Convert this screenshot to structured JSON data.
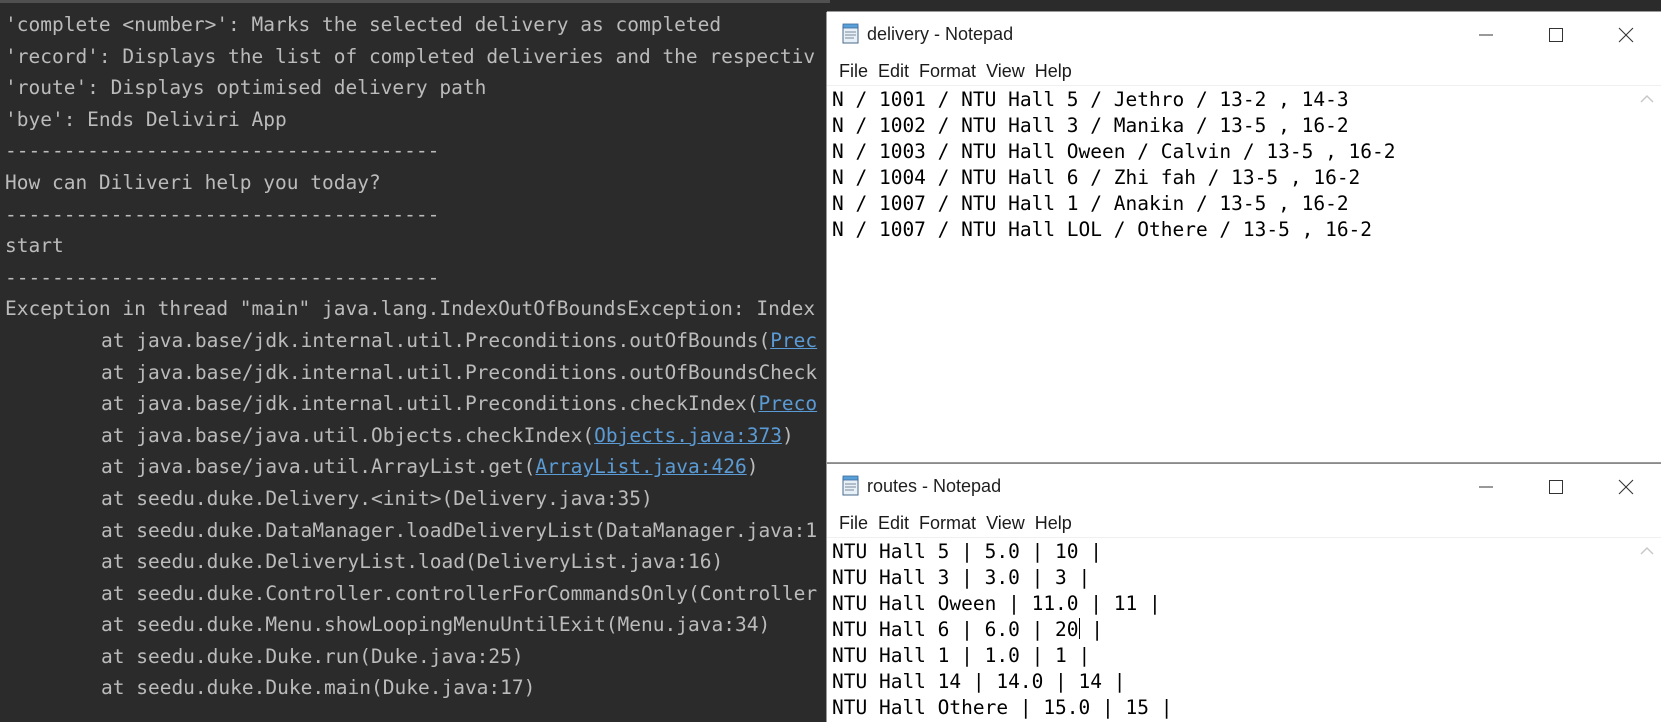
{
  "terminal": {
    "lines": [
      {
        "type": "plain",
        "text": "'complete <number>': Marks the selected delivery as completed"
      },
      {
        "type": "plain",
        "text": "'record': Displays the list of completed deliveries and the respectiv"
      },
      {
        "type": "plain",
        "text": "'route': Displays optimised delivery path"
      },
      {
        "type": "plain",
        "text": "'bye': Ends Deliviri App"
      },
      {
        "type": "plain",
        "text": "-------------------------------------"
      },
      {
        "type": "plain",
        "text": "How can Diliveri help you today?"
      },
      {
        "type": "plain",
        "text": "-------------------------------------"
      },
      {
        "type": "plain",
        "text": "start"
      },
      {
        "type": "plain",
        "text": "-------------------------------------"
      },
      {
        "type": "plain",
        "text": "Exception in thread \"main\" java.lang.IndexOutOfBoundsException: Index"
      },
      {
        "type": "stack",
        "pre": "at java.base/jdk.internal.util.Preconditions.outOfBounds(",
        "link": "Prec",
        "post": ""
      },
      {
        "type": "stack",
        "pre": "at java.base/jdk.internal.util.Preconditions.outOfBoundsCheck",
        "link": "",
        "post": ""
      },
      {
        "type": "stack",
        "pre": "at java.base/jdk.internal.util.Preconditions.checkIndex(",
        "link": "Preco",
        "post": ""
      },
      {
        "type": "stack",
        "pre": "at java.base/java.util.Objects.checkIndex(",
        "link": "Objects.java:373",
        "post": ")"
      },
      {
        "type": "stack",
        "pre": "at java.base/java.util.ArrayList.get(",
        "link": "ArrayList.java:426",
        "post": ")"
      },
      {
        "type": "stack",
        "pre": "at seedu.duke.Delivery.<init>(Delivery.java:35)",
        "link": "",
        "post": ""
      },
      {
        "type": "stack",
        "pre": "at seedu.duke.DataManager.loadDeliveryList(DataManager.java:1",
        "link": "",
        "post": ""
      },
      {
        "type": "stack",
        "pre": "at seedu.duke.DeliveryList.load(DeliveryList.java:16)",
        "link": "",
        "post": ""
      },
      {
        "type": "stack",
        "pre": "at seedu.duke.Controller.controllerForCommandsOnly(Controller",
        "link": "",
        "post": ""
      },
      {
        "type": "stack",
        "pre": "at seedu.duke.Menu.showLoopingMenuUntilExit(Menu.java:34)",
        "link": "",
        "post": ""
      },
      {
        "type": "stack",
        "pre": "at seedu.duke.Duke.run(Duke.java:25)",
        "link": "",
        "post": ""
      },
      {
        "type": "stack",
        "pre": "at seedu.duke.Duke.main(Duke.java:17)",
        "link": "",
        "post": ""
      }
    ]
  },
  "delivery_window": {
    "title": "delivery - Notepad",
    "menu": [
      "File",
      "Edit",
      "Format",
      "View",
      "Help"
    ],
    "lines": [
      "N / 1001 / NTU Hall 5 / Jethro / 13-2 , 14-3",
      "N / 1002 / NTU Hall 3 / Manika / 13-5 , 16-2",
      "N / 1003 / NTU Hall Oween / Calvin / 13-5 , 16-2",
      "N / 1004 / NTU Hall 6 / Zhi fah / 13-5 , 16-2",
      "N / 1007 / NTU Hall 1 / Anakin / 13-5 , 16-2",
      "N / 1007 / NTU Hall LOL / Othere / 13-5 , 16-2"
    ]
  },
  "routes_window": {
    "title": "routes - Notepad",
    "menu": [
      "File",
      "Edit",
      "Format",
      "View",
      "Help"
    ],
    "lines": [
      "NTU Hall 5 | 5.0 | 10 |",
      "NTU Hall 3 | 3.0 | 3 |",
      "NTU Hall Oween | 11.0 | 11 |",
      "NTU Hall 6 | 6.0 | 20 |",
      "NTU Hall 1 | 1.0 | 1 |",
      "NTU Hall 14 | 14.0 | 14 |",
      "NTU Hall Othere | 15.0 | 15 |"
    ],
    "caret_line": 3,
    "caret_after": "NTU Hall 6 | 6.0 | 20"
  },
  "colors": {
    "terminal_bg": "#2b2b2b",
    "terminal_text": "#bbbbbb",
    "link": "#5b9bd5",
    "notepad_bg": "#ffffff"
  }
}
